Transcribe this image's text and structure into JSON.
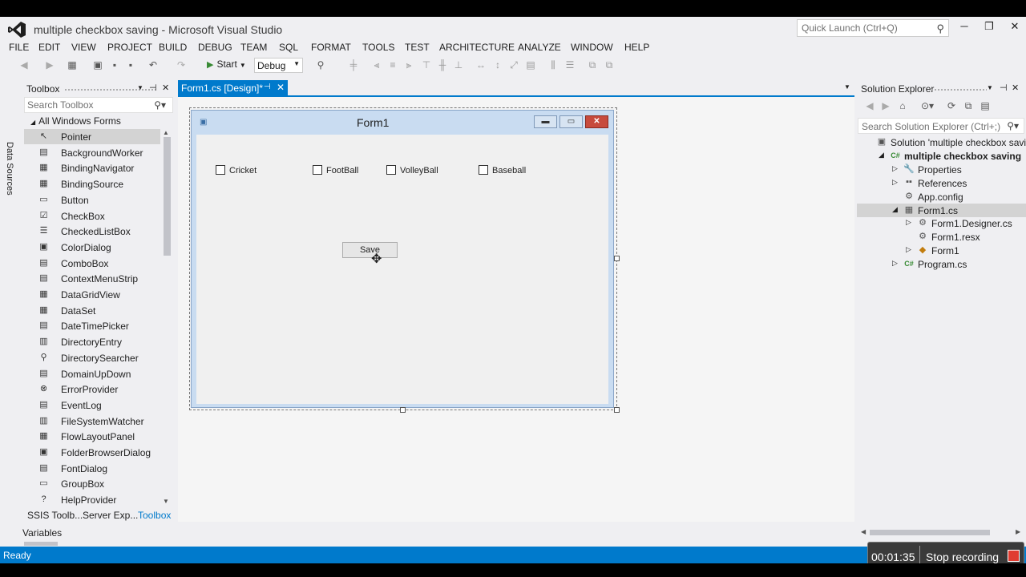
{
  "window": {
    "title": "multiple checkbox saving - Microsoft Visual Studio",
    "quick_launch_placeholder": "Quick Launch (Ctrl+Q)",
    "min": "─",
    "restore": "❐",
    "close": "✕"
  },
  "menu": [
    "FILE",
    "EDIT",
    "VIEW",
    "PROJECT",
    "BUILD",
    "DEBUG",
    "TEAM",
    "SQL",
    "FORMAT",
    "TOOLS",
    "TEST",
    "ARCHITECTURE",
    "ANALYZE",
    "WINDOW",
    "HELP"
  ],
  "toolbar": {
    "start_label": "Start",
    "config": "Debug"
  },
  "side_rail": {
    "data_sources": "Data Sources"
  },
  "toolbox": {
    "title": "Toolbox",
    "search_placeholder": "Search Toolbox",
    "group": "All Windows Forms",
    "items": [
      {
        "label": "Pointer",
        "icon": "pointer-icon",
        "glyph": "↖"
      },
      {
        "label": "BackgroundWorker",
        "icon": "background-worker-icon",
        "glyph": "▤"
      },
      {
        "label": "BindingNavigator",
        "icon": "binding-navigator-icon",
        "glyph": "▦"
      },
      {
        "label": "BindingSource",
        "icon": "binding-source-icon",
        "glyph": "▦"
      },
      {
        "label": "Button",
        "icon": "button-icon",
        "glyph": "▭"
      },
      {
        "label": "CheckBox",
        "icon": "checkbox-icon",
        "glyph": "☑"
      },
      {
        "label": "CheckedListBox",
        "icon": "checked-list-box-icon",
        "glyph": "☰"
      },
      {
        "label": "ColorDialog",
        "icon": "color-dialog-icon",
        "glyph": "▣"
      },
      {
        "label": "ComboBox",
        "icon": "combobox-icon",
        "glyph": "▤"
      },
      {
        "label": "ContextMenuStrip",
        "icon": "context-menu-strip-icon",
        "glyph": "▤"
      },
      {
        "label": "DataGridView",
        "icon": "data-grid-view-icon",
        "glyph": "▦"
      },
      {
        "label": "DataSet",
        "icon": "dataset-icon",
        "glyph": "▦"
      },
      {
        "label": "DateTimePicker",
        "icon": "date-time-picker-icon",
        "glyph": "▤"
      },
      {
        "label": "DirectoryEntry",
        "icon": "directory-entry-icon",
        "glyph": "▥"
      },
      {
        "label": "DirectorySearcher",
        "icon": "directory-searcher-icon",
        "glyph": "⚲"
      },
      {
        "label": "DomainUpDown",
        "icon": "domain-up-down-icon",
        "glyph": "▤"
      },
      {
        "label": "ErrorProvider",
        "icon": "error-provider-icon",
        "glyph": "⊗"
      },
      {
        "label": "EventLog",
        "icon": "event-log-icon",
        "glyph": "▤"
      },
      {
        "label": "FileSystemWatcher",
        "icon": "file-system-watcher-icon",
        "glyph": "▥"
      },
      {
        "label": "FlowLayoutPanel",
        "icon": "flow-layout-panel-icon",
        "glyph": "▦"
      },
      {
        "label": "FolderBrowserDialog",
        "icon": "folder-browser-dialog-icon",
        "glyph": "▣"
      },
      {
        "label": "FontDialog",
        "icon": "font-dialog-icon",
        "glyph": "▤"
      },
      {
        "label": "GroupBox",
        "icon": "groupbox-icon",
        "glyph": "▭"
      },
      {
        "label": "HelpProvider",
        "icon": "help-provider-icon",
        "glyph": "?"
      }
    ],
    "bottom_tabs": [
      "SSIS Toolb...",
      "Server Exp...",
      "Toolbox"
    ]
  },
  "variables_label": "Variables",
  "document_tab": {
    "label": "Form1.cs [Design]*"
  },
  "form": {
    "title": "Form1",
    "checkboxes": [
      "Cricket",
      "FootBall",
      "VolleyBall",
      "Baseball"
    ],
    "save_label": "Save"
  },
  "solution_explorer": {
    "title": "Solution Explorer",
    "search_placeholder": "Search Solution Explorer (Ctrl+;)",
    "nodes": [
      {
        "label": "Solution 'multiple checkbox saving'",
        "icon": "solution-icon",
        "glyph": "▣",
        "exp": "",
        "bold": false,
        "color": "#555"
      },
      {
        "label": "multiple checkbox saving",
        "icon": "csharp-project-icon",
        "glyph": "C#",
        "exp": "◢",
        "bold": true,
        "color": "#388a34"
      },
      {
        "label": "Properties",
        "icon": "properties-icon",
        "glyph": "🔧",
        "exp": "▷",
        "bold": false,
        "color": "#555"
      },
      {
        "label": "References",
        "icon": "references-icon",
        "glyph": "▪▪",
        "exp": "▷",
        "bold": false,
        "color": "#555"
      },
      {
        "label": "App.config",
        "icon": "config-file-icon",
        "glyph": "⚙",
        "exp": "",
        "bold": false,
        "color": "#555"
      },
      {
        "label": "Form1.cs",
        "icon": "form-file-icon",
        "glyph": "▦",
        "exp": "◢",
        "bold": false,
        "color": "#555"
      },
      {
        "label": "Form1.Designer.cs",
        "icon": "designer-file-icon",
        "glyph": "⚙",
        "exp": "▷",
        "bold": false,
        "color": "#555"
      },
      {
        "label": "Form1.resx",
        "icon": "resx-file-icon",
        "glyph": "⚙",
        "exp": "",
        "bold": false,
        "color": "#555"
      },
      {
        "label": "Form1",
        "icon": "class-icon",
        "glyph": "◆",
        "exp": "▷",
        "bold": false,
        "color": "#c27d0e"
      },
      {
        "label": "Program.cs",
        "icon": "csharp-file-icon",
        "glyph": "C#",
        "exp": "▷",
        "bold": false,
        "color": "#388a34"
      }
    ]
  },
  "status": {
    "text": "Ready"
  },
  "recording": {
    "time": "00:01:35",
    "stop_label": "Stop recording"
  },
  "colors": {
    "accent": "#007acc",
    "chrome": "#efeff2",
    "record_stop": "#e03c31"
  }
}
